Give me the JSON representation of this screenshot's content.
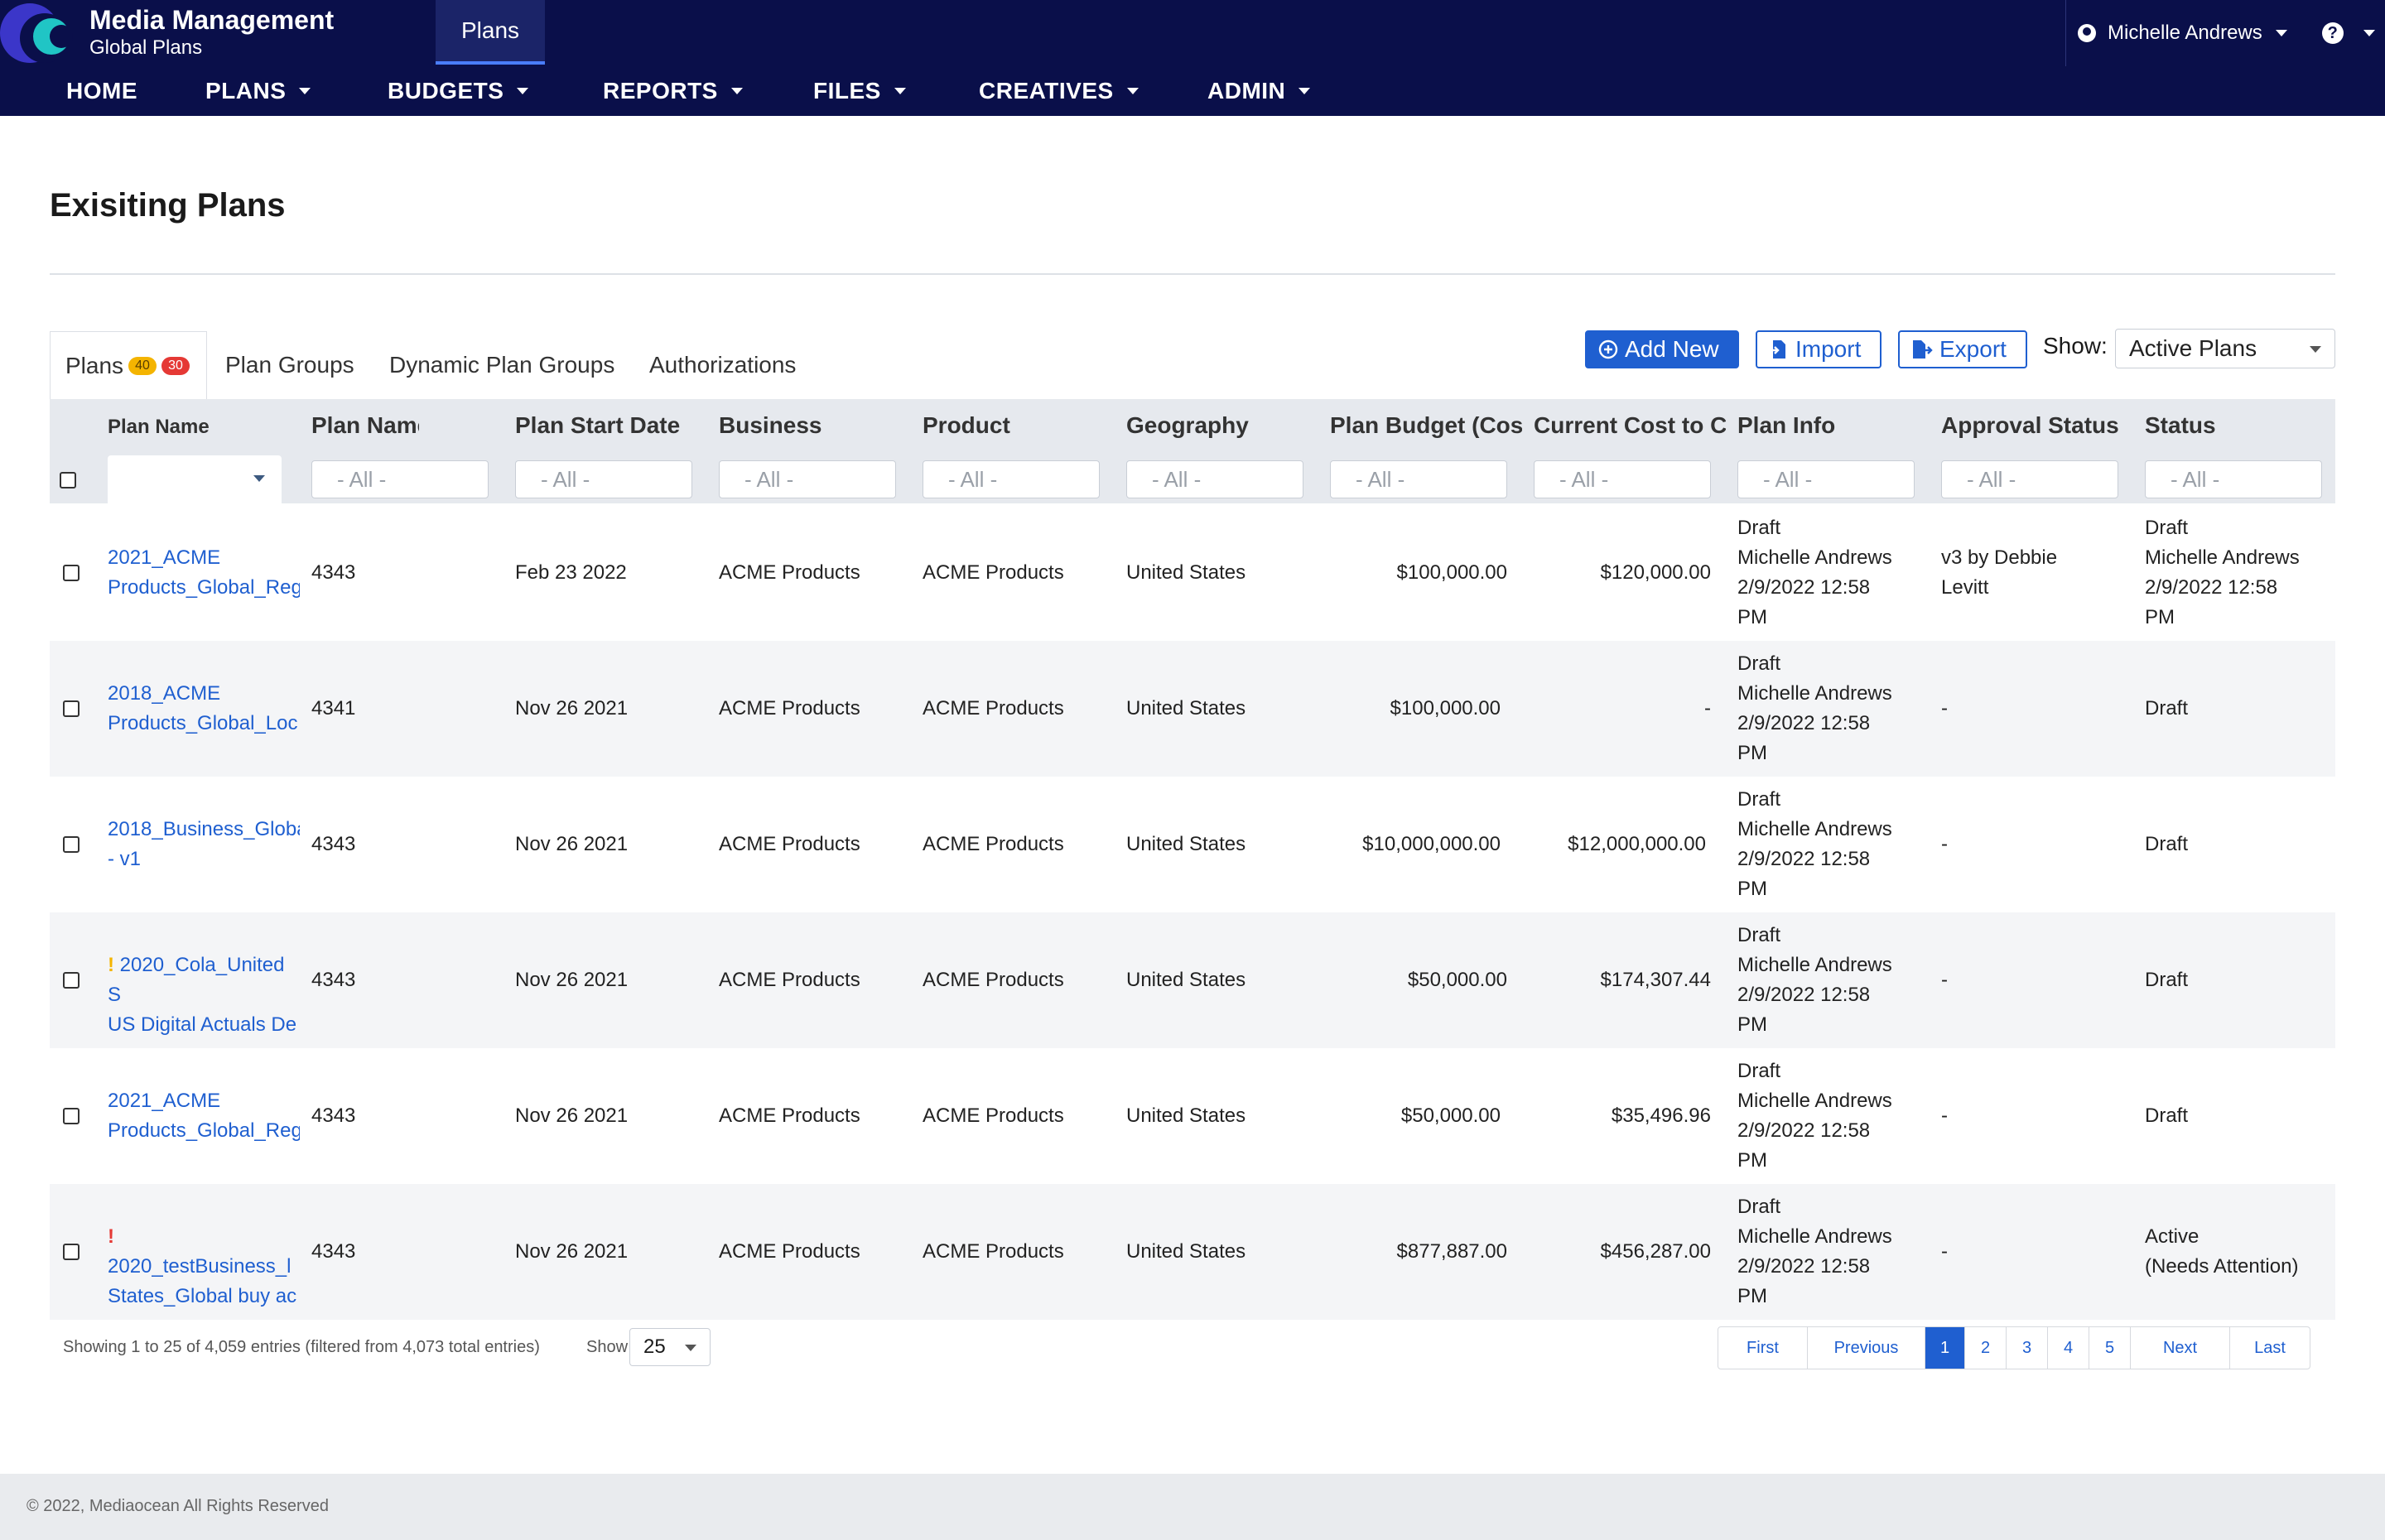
{
  "app": {
    "title": "Media Management",
    "subtitle": "Global Plans",
    "active_module": "Plans"
  },
  "user": {
    "name": "Michelle Andrews",
    "help": "?"
  },
  "nav": [
    "HOME",
    "PLANS",
    "BUDGETS",
    "REPORTS",
    "FILES",
    "CREATIVES",
    "ADMIN"
  ],
  "page_title": "Exisiting Plans",
  "tabs": {
    "plans": "Plans",
    "plans_badge_yellow": "40",
    "plans_badge_red": "30",
    "plan_groups": "Plan Groups",
    "dynamic_plan_groups": "Dynamic Plan Groups",
    "authorizations": "Authorizations"
  },
  "toolbar": {
    "add_new": "Add New",
    "import": "Import",
    "export": "Export",
    "show_label": "Show:",
    "show_value": "Active Plans"
  },
  "columns": [
    "Plan Name",
    "Plan Name",
    "Plan Start Date",
    "Business",
    "Product",
    "Geography",
    "Plan Budget (Cost",
    "Current Cost to C",
    "Plan Info",
    "Approval Status",
    "Status"
  ],
  "filter_placeholder": "- All -",
  "rows": [
    {
      "name_line1": "2021_ACME",
      "name_line2": "Products_Global_Reg",
      "warn": "",
      "id": "4343",
      "start": "Feb 23 2022",
      "business": "ACME Products",
      "product": "ACME Products",
      "geo": "United States",
      "budget": "$100,000.00",
      "cost": "$120,000.00",
      "info": [
        "Draft",
        "Michelle Andrews",
        "2/9/2022 12:58",
        "PM"
      ],
      "approval": [
        "v3 by Debbie",
        "Levitt"
      ],
      "status": [
        "Draft",
        "Michelle Andrews",
        "2/9/2022 12:58",
        "PM"
      ]
    },
    {
      "name_line1": "2018_ACME",
      "name_line2": "Products_Global_Loc",
      "warn": "",
      "id": "4341",
      "start": "Nov 26 2021",
      "business": "ACME Products",
      "product": "ACME Products",
      "geo": "United States",
      "budget": "$100,000.00",
      "cost": "-",
      "info": [
        "Draft",
        "Michelle Andrews",
        "2/9/2022 12:58",
        "PM"
      ],
      "approval": [
        "-"
      ],
      "status": [
        "Draft"
      ]
    },
    {
      "name_line1": "2018_Business_Globa",
      "name_line2": "- v1",
      "warn": "",
      "id": "4343",
      "start": "Nov 26 2021",
      "business": "ACME Products",
      "product": "ACME Products",
      "geo": "United States",
      "budget": "$10,000,000.00",
      "cost": "$12,000,000.00",
      "info": [
        "Draft",
        "Michelle Andrews",
        "2/9/2022 12:58",
        "PM"
      ],
      "approval": [
        "-"
      ],
      "status": [
        "Draft"
      ]
    },
    {
      "name_line1": "2020_Cola_United S",
      "name_line2": "US Digital Actuals De",
      "warn": "!",
      "id": "4343",
      "start": "Nov 26 2021",
      "business": "ACME Products",
      "product": "ACME Products",
      "geo": "United States",
      "budget": "$50,000.00",
      "cost": "$174,307.44",
      "info": [
        "Draft",
        "Michelle Andrews",
        "2/9/2022 12:58",
        "PM"
      ],
      "approval": [
        "-"
      ],
      "status": [
        "Draft"
      ]
    },
    {
      "name_line1": "2021_ACME",
      "name_line2": "Products_Global_Reg",
      "warn": "",
      "id": "4343",
      "start": "Nov 26 2021",
      "business": "ACME Products",
      "product": "ACME Products",
      "geo": "United States",
      "budget": "$50,000.00",
      "cost": "$35,496.96",
      "info": [
        "Draft",
        "Michelle Andrews",
        "2/9/2022 12:58",
        "PM"
      ],
      "approval": [
        "-"
      ],
      "status": [
        "Draft"
      ]
    },
    {
      "name_line1": "2020_testBusiness_l",
      "name_line2": "States_Global buy ac",
      "warn": "!",
      "id": "4343",
      "start": "Nov 26 2021",
      "business": "ACME Products",
      "product": "ACME Products",
      "geo": "United States",
      "budget": "$877,887.00",
      "cost": "$456,287.00",
      "info": [
        "Draft",
        "Michelle Andrews",
        "2/9/2022 12:58",
        "PM"
      ],
      "approval": [
        "-"
      ],
      "status": [
        "Active",
        "(Needs Attention)"
      ]
    }
  ],
  "footer_info": "Showing 1 to 25 of 4,059 entries (filtered from 4,073 total entries)",
  "page_size_label": "Show",
  "page_size": "25",
  "pager": [
    "First",
    "Previous",
    "1",
    "2",
    "3",
    "4",
    "5",
    "Next",
    "Last"
  ],
  "copyright": "© 2022, Mediaocean All Rights Reserved",
  "colors": {
    "header_bg": "#0a0f4a",
    "accent": "#1f5fd0",
    "badge_yellow": "#f4b400",
    "badge_red": "#e53935",
    "warn_yellow": "#f4b400",
    "warn_red": "#e53935"
  }
}
